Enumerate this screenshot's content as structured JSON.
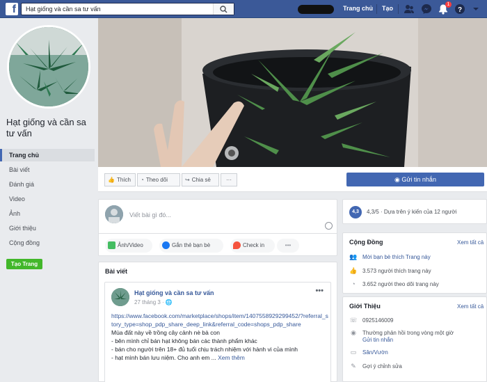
{
  "topbar": {
    "search_value": "Hạt giống và cần sa tư vấn",
    "links": [
      "Trang chủ",
      "Tạo"
    ],
    "notification_count": "1",
    "brand_color": "#3b5998"
  },
  "sidebar": {
    "page_name": "Hạt giống và cần sa tư vấn",
    "items": [
      {
        "label": "Trang chủ",
        "active": true
      },
      {
        "label": "Bài viết"
      },
      {
        "label": "Đánh giá"
      },
      {
        "label": "Video"
      },
      {
        "label": "Ảnh"
      },
      {
        "label": "Giới thiệu"
      },
      {
        "label": "Cộng đồng"
      }
    ],
    "create_page_label": "Tạo Trang"
  },
  "actions": {
    "like": "Thích",
    "follow": "Theo dõi",
    "share": "Chia sẻ",
    "more": "···",
    "message": "Gửi tin nhắn"
  },
  "composer": {
    "placeholder": "Viết bài gì đó...",
    "photo_video": "Ảnh/Video",
    "tag_friends": "Gắn thẻ bạn bè",
    "check_in": "Check in",
    "more": "•••"
  },
  "posts": {
    "section_title": "Bài viết",
    "author": "Hạt giống và cần sa tư vấn",
    "date": "27 tháng 3 · ",
    "link": "https://www.facebook.com/marketplace/shops/item/1407558929299452/?referral_story_type=shop_pdp_share_deep_link&referral_code=shops_pdp_share",
    "lines": [
      "Mùa đất này về trồng cây cảnh nè bà con",
      "- bên mình chỉ bán hạt không bán các thành phẩm khác",
      "- bán cho người trên 18+ đủ tuổi chịu trách nhiệm với hành vi của mình",
      "- hạt mình bán lưu niệm. Cho anh em ...",
      "Xem thêm"
    ]
  },
  "rating": {
    "score": "4,3",
    "text": "4,3/5 · Dựa trên ý kiến của 12 người"
  },
  "community": {
    "title": "Cộng Đồng",
    "see_all": "Xem tất cả",
    "rows": [
      "Mời bạn bè thích Trang này",
      "3.573 người thích trang này",
      "3.652 người theo dõi trang này"
    ]
  },
  "about": {
    "title": "Giới Thiệu",
    "see_all": "Xem tất cả",
    "phone": "0925146009",
    "response": "Thường phản hồi trong vòng một giờ",
    "send_message": "Gửi tin nhắn",
    "category": "Sân/Vườn",
    "suggest_edit": "Gợi ý chỉnh sửa"
  }
}
